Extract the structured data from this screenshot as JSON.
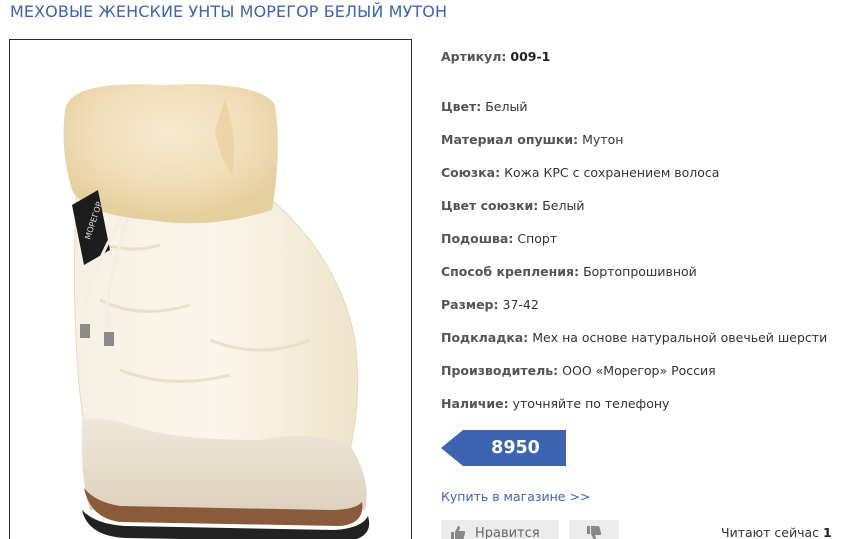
{
  "product": {
    "title": "МЕХОВЫЕ ЖЕНСКИЕ УНТЫ МОРЕГОР БЕЛЫЙ МУТОН",
    "image_alt": "Белые меховые унты",
    "brand_tag": "МОРЕГОР"
  },
  "specs": [
    {
      "label": "Артикул:",
      "value": "009-1",
      "bold_value": true
    },
    {
      "label": "Цвет:",
      "value": "Белый"
    },
    {
      "label": "Материал опушки:",
      "value": "Мутон"
    },
    {
      "label": "Союзка:",
      "value": "Кожа КРС с сохранением волоса"
    },
    {
      "label": "Цвет союзки:",
      "value": "Белый"
    },
    {
      "label": "Подошва:",
      "value": "Спорт"
    },
    {
      "label": "Способ крепления:",
      "value": "Бортопрошивной"
    },
    {
      "label": "Размер:",
      "value": "37-42"
    },
    {
      "label": "Подкладка:",
      "value": "Мех на основе натуральной овечьей шерсти"
    },
    {
      "label": "Производитель:",
      "value": "ООО «Морегор» Россия"
    },
    {
      "label": "Наличие:",
      "value": "уточняйте по телефону"
    }
  ],
  "price": {
    "text": "8950 руб.",
    "color": "#3d64b1"
  },
  "buy_link": "Купить в магазине >>",
  "social": {
    "like_label": "Нравится",
    "like_icon": "thumbs-up-icon",
    "dislike_icon": "thumbs-down-icon",
    "readers_label": "Читают сейчас",
    "readers_count": "1"
  },
  "colors": {
    "title_blue": "#3d64b1",
    "button_gray": "#ececec"
  }
}
